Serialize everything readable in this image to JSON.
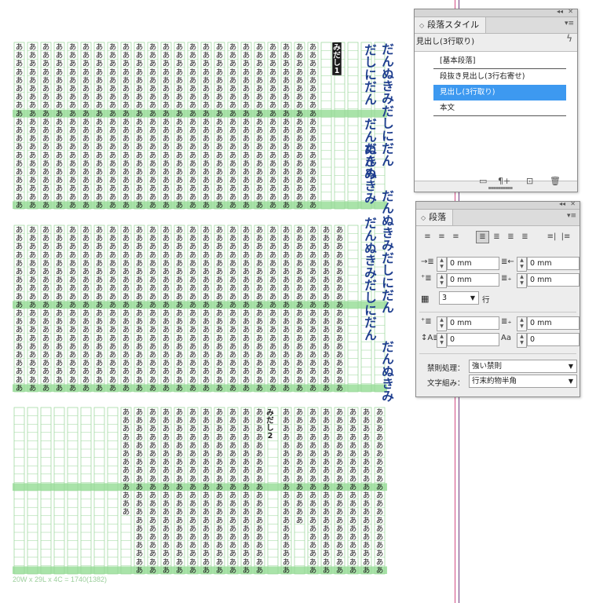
{
  "document": {
    "frame_info": "20W x 29L x 4C = 1740(1382)",
    "glyph": "あ",
    "headline_text": "だんぬきみだしにだん",
    "midashi1_label": "みだし1",
    "midashi2_label": "みだし2",
    "guide_colors": [
      "#d24a84",
      "#6f3c7e"
    ]
  },
  "style_panel": {
    "title": "段落スタイル",
    "current_style": "見出し(3行取り)",
    "styles": [
      {
        "label": "[基本段落]",
        "selected": false
      },
      {
        "label": "段抜き見出し(3行右寄せ)",
        "selected": false
      },
      {
        "label": "見出し(3行取り)",
        "selected": true
      },
      {
        "label": "本文",
        "selected": false
      }
    ],
    "footer_icons": [
      "folder-icon",
      "clear-overrides-icon",
      "new-style-icon",
      "trash-icon"
    ]
  },
  "para_panel": {
    "title": "段落",
    "left_indent": "0 mm",
    "right_indent": "0 mm",
    "first_indent": "0 mm",
    "last_indent": "0 mm",
    "line_count": "3",
    "line_unit": "行",
    "space_before": "0 mm",
    "space_after": "0 mm",
    "drop_lines": "0",
    "drop_chars": "0",
    "kinsoku_label": "禁則処理：",
    "kinsoku_value": "強い禁則",
    "mojikumi_label": "文字組み：",
    "mojikumi_value": "行末約物半角"
  },
  "colors": {
    "grid_line": "#98d498",
    "grid_fill": "#a9e3a9",
    "text_dark": "#1a1a1a",
    "headline_blue": "#1f3f8f",
    "selection": "#3d99f0"
  }
}
